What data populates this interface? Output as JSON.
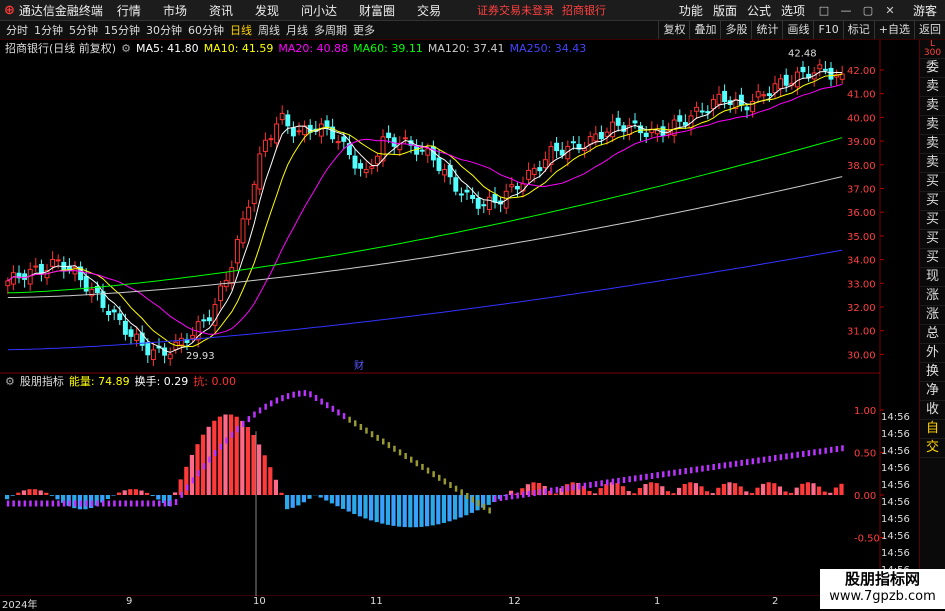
{
  "app": {
    "title": "通达信金融终端",
    "menu": [
      "行情",
      "市场",
      "资讯",
      "发现",
      "问小达",
      "财富圈",
      "交易"
    ],
    "notice_login": "证券交易未登录",
    "notice_stock": "招商银行",
    "right_menu": [
      "功能",
      "版面",
      "公式",
      "选项"
    ],
    "user": "游客",
    "win_buttons": [
      "□",
      "—",
      "▢",
      "✕"
    ]
  },
  "periods": [
    "分时",
    "1分钟",
    "5分钟",
    "15分钟",
    "30分钟",
    "60分钟",
    "日线",
    "周线",
    "月线",
    "多周期",
    "更多"
  ],
  "active_period": "日线",
  "tools": [
    "复权",
    "叠加",
    "多股",
    "统计",
    "画线",
    "F10",
    "标记",
    "+自选",
    "返回"
  ],
  "info": {
    "stock": "招商银行(日线 前复权)",
    "ma5": "MA5: 41.80",
    "ma10": "MA10: 41.59",
    "ma20": "MA20: 40.88",
    "ma60": "MA60: 39.11",
    "ma120": "MA120: 37.41",
    "ma250": "MA250: 34.43"
  },
  "side": [
    "委比",
    "卖五",
    "卖四",
    "卖三",
    "卖二",
    "卖一",
    "买一",
    "买二",
    "买三",
    "买四",
    "买五",
    "现价",
    "涨跌",
    "涨幅",
    "总量",
    "外盘",
    "换手",
    "净资",
    "收益",
    "自动",
    "交易"
  ],
  "side_top": "L",
  "side_top2": "300",
  "price_labels": [
    "42.00",
    "41.00",
    "40.00",
    "39.00",
    "38.00",
    "37.00",
    "36.00",
    "35.00",
    "34.00",
    "33.00",
    "32.00",
    "31.00",
    "30.00"
  ],
  "price_high_label": "42.48",
  "price_low_label": "29.93",
  "fin_marker": "财",
  "indicator": {
    "name": "股朋指标",
    "energy": "能量: 74.89",
    "turnover": "换手: 0.29",
    "kang": "抗: 0.00",
    "labels": [
      "1.00",
      "0.50",
      "0.00",
      "-0.50"
    ],
    "extra_axis": [
      "14:56",
      "14:56",
      "14:56",
      "14:56",
      "14:56",
      "14:56",
      "14:56",
      "14:56",
      "14:56",
      "14:56",
      "14:56"
    ]
  },
  "timeaxis": {
    "labels": [
      "2024年",
      "9",
      "10",
      "11",
      "12",
      "1",
      "2"
    ]
  },
  "watermark": {
    "line1": "股朋指标网",
    "line2": "www.7gpzb.com"
  },
  "colors": {
    "up": "#ff3232",
    "down": "#54ffff",
    "ma5": "#ffffff",
    "ma10": "#ffff00",
    "ma20": "#ff00ff",
    "ma60": "#00ff00",
    "ma120": "#cccccc",
    "ma250": "#3333ff"
  }
}
